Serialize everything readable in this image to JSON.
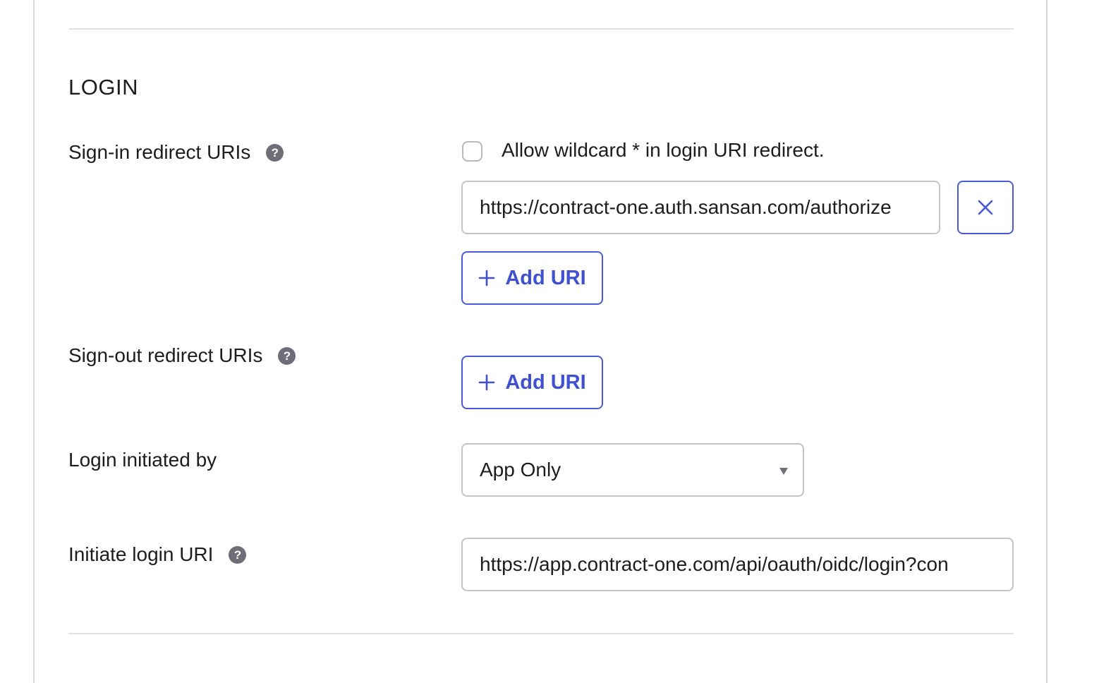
{
  "section": {
    "title": "LOGIN"
  },
  "sign_in": {
    "label": "Sign-in redirect URIs",
    "help_icon": "question-circle-icon",
    "wildcard_label": "Allow wildcard * in login URI redirect.",
    "wildcard_checked": false,
    "uri_value": "https://contract-one.auth.sansan.com/authorize",
    "remove_icon": "close-icon",
    "add_label": "Add URI"
  },
  "sign_out": {
    "label": "Sign-out redirect URIs",
    "help_icon": "question-circle-icon",
    "add_label": "Add URI"
  },
  "login_initiated_by": {
    "label": "Login initiated by",
    "selected": "App Only"
  },
  "initiate_login_uri": {
    "label": "Initiate login URI",
    "help_icon": "question-circle-icon",
    "value": "https://app.contract-one.com/api/oauth/oidc/login?con"
  },
  "colors": {
    "accent": "#4a5ad6",
    "border": "#c4c4c9",
    "help_icon_bg": "#6e6e78"
  }
}
